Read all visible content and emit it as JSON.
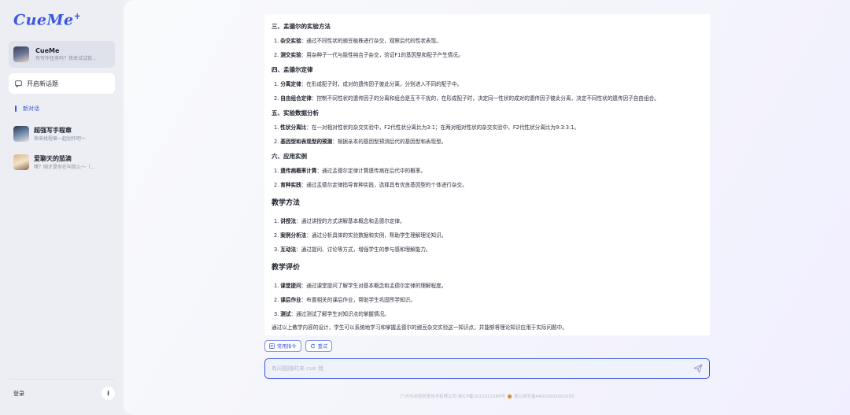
{
  "sidebar": {
    "logo": "CueMe",
    "logo_plus": "+",
    "profile": {
      "name": "CueMe",
      "subtitle": "有写作任务吗？快来试试我..."
    },
    "new_topic": "开启新话题",
    "new_chat": "新对话",
    "assistants": [
      {
        "name": "超强写手程章",
        "subtitle": "快来找程章一起创作吧～"
      },
      {
        "name": "爱聊天的茄滴",
        "subtitle": "嘿？刚才是你在叫我么～（..."
      }
    ],
    "login": "登录",
    "info_icon": "i"
  },
  "content": {
    "sections": [
      {
        "heading": "三、孟德尔的实验方法",
        "level": 3,
        "items": [
          {
            "num": "1.",
            "term": "杂交实验",
            "text": "：通过不同性状的豌豆植株进行杂交，观察后代的性状表现。"
          },
          {
            "num": "2.",
            "term": "测交实验",
            "text": "：用杂种子一代与隐性纯合子杂交，验证F1的基因型和配子产生情况。"
          }
        ]
      },
      {
        "heading": "四、孟德尔定律",
        "level": 3,
        "items": [
          {
            "num": "1.",
            "term": "分离定律",
            "text": "：在形成配子时，成对的遗传因子彼此分离，分别进入不同的配子中。"
          },
          {
            "num": "2.",
            "term": "自由组合定律",
            "text": "：控制不同性状的遗传因子的分离和组合是互不干扰的，在形成配子时，决定同一性状的成对的遗传因子彼此分离，决定不同性状的遗传因子自由组合。"
          }
        ]
      },
      {
        "heading": "五、实验数据分析",
        "level": 3,
        "items": [
          {
            "num": "1.",
            "term": "性状分离比",
            "text": "：在一对相对性状的杂交实验中，F2代性状分离比为3:1；在两对相对性状的杂交实验中，F2代性状分离比为9:3:3:1。"
          },
          {
            "num": "2.",
            "term": "基因型和表现型的预测",
            "text": "：根据亲本的基因型预测后代的基因型和表现型。"
          }
        ]
      },
      {
        "heading": "六、应用实例",
        "level": 3,
        "items": [
          {
            "num": "1.",
            "term": "遗传病概率计算",
            "text": "：通过孟德尔定律计算遗传病在后代中的概率。"
          },
          {
            "num": "2.",
            "term": "育种实践",
            "text": "：通过孟德尔定律指导育种实践，选择具有优良基因型的个体进行杂交。"
          }
        ]
      },
      {
        "heading": "教学方法",
        "level": 2,
        "items": [
          {
            "num": "1.",
            "term": "讲授法",
            "text": "：通过讲授的方式讲解基本概念和孟德尔定律。"
          },
          {
            "num": "2.",
            "term": "案例分析法",
            "text": "：通过分析具体的实验数据和实例，帮助学生理解理论知识。"
          },
          {
            "num": "3.",
            "term": "互动法",
            "text": "：通过提问、讨论等方式，增强学生的参与感和理解能力。"
          }
        ]
      },
      {
        "heading": "教学评价",
        "level": 2,
        "items": [
          {
            "num": "1.",
            "term": "课堂提问",
            "text": "：通过课堂提问了解学生对基本概念和孟德尔定律的理解程度。"
          },
          {
            "num": "2.",
            "term": "课后作业",
            "text": "：布置相关的课后作业，帮助学生巩固所学知识。"
          },
          {
            "num": "3.",
            "term": "测试",
            "text": "：通过测试了解学生对知识点的掌握情况。"
          }
        ]
      }
    ],
    "tail": "通过以上教学内容的设计，学生可以系统地学习和掌握孟德尔的豌豆杂交实验这一知识点，并能够将理论知识应用于实际问题中。"
  },
  "chips": {
    "common": "常用指令",
    "retry": "重试"
  },
  "input": {
    "placeholder": "有问题随时来 cue 我",
    "value": ""
  },
  "footer": {
    "company": "广州市动视创意技术有限公司 粤ICP备2022013384号",
    "police": "粤公网安备44010502003255"
  },
  "colors": {
    "accent": "#3c55e6",
    "sidebar_bg": "#eceef4",
    "police_badge": "#d9882a"
  }
}
